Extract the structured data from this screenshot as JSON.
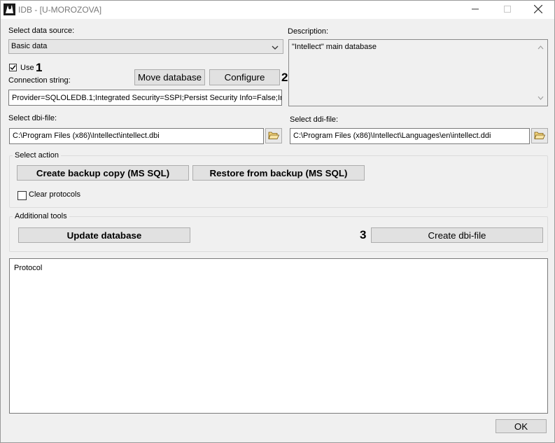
{
  "window": {
    "title": "IDB - [U-MOROZOVA]"
  },
  "data_source": {
    "label": "Select data source:",
    "selected": "Basic data"
  },
  "use_checkbox": {
    "label": "Use",
    "checked": true
  },
  "connection": {
    "label": "Connection string:",
    "value": "Provider=SQLOLEDB.1;Integrated Security=SSPI;Persist Security Info=False;Initial Catalog=intellect;Data Source=."
  },
  "buttons": {
    "move_database": "Move database",
    "configure": "Configure",
    "create_backup": "Create backup copy (MS SQL)",
    "restore_backup": "Restore from backup (MS SQL)",
    "update_database": "Update database",
    "create_dbi": "Create dbi-file",
    "ok": "OK"
  },
  "description": {
    "label": "Description:",
    "value": "\"Intellect\" main database"
  },
  "dbi": {
    "label": "Select dbi-file:",
    "value": "C:\\Program Files (x86)\\Intellect\\intellect.dbi"
  },
  "ddi": {
    "label": "Select ddi-file:",
    "value": "C:\\Program Files (x86)\\Intellect\\Languages\\en\\intellect.ddi"
  },
  "select_action": {
    "title": "Select action",
    "clear_protocols_label": "Clear protocols"
  },
  "additional_tools": {
    "title": "Additional tools"
  },
  "protocol": {
    "value": "Protocol"
  },
  "markers": {
    "m1": "1",
    "m2": "2",
    "m3": "3"
  },
  "icons": {
    "app": "app-icon",
    "minimize": "minimize-icon",
    "maximize": "maximize-icon",
    "close": "close-icon",
    "dropdown": "chevron-down-icon",
    "folder": "folder-open-icon"
  }
}
